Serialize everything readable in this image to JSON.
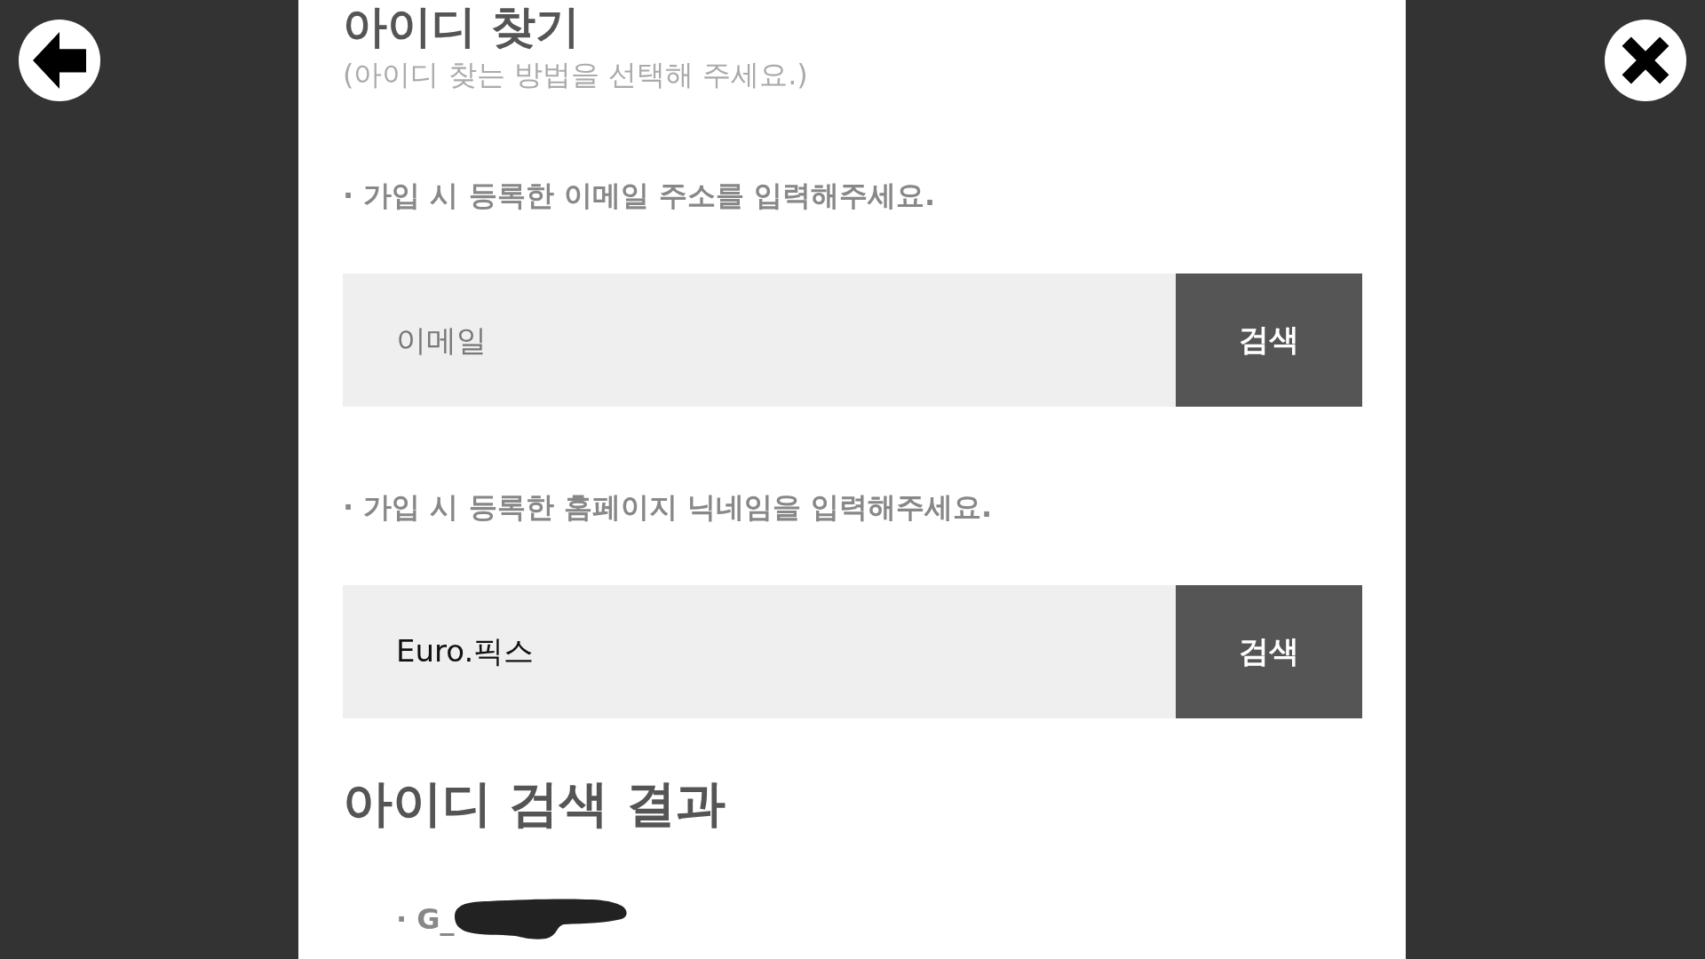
{
  "title": "아이디 찾기",
  "subtitle": "(아이디 찾는 방법을 선택해 주세요.)",
  "search_fields": [
    {
      "label": "· 가입 시 등록한 이메일 주소를 입력해주세요.",
      "placeholder": "이메일",
      "button": "검색"
    },
    {
      "label": "· 가입 시 등록한 홈페이지 닉네임을 입력해주세요.",
      "value": "Euro.픽스",
      "button": "검색"
    }
  ],
  "results": {
    "heading": "아이디 검색 결과",
    "items": [
      {
        "text": "· G_",
        "redacted": true
      }
    ]
  }
}
